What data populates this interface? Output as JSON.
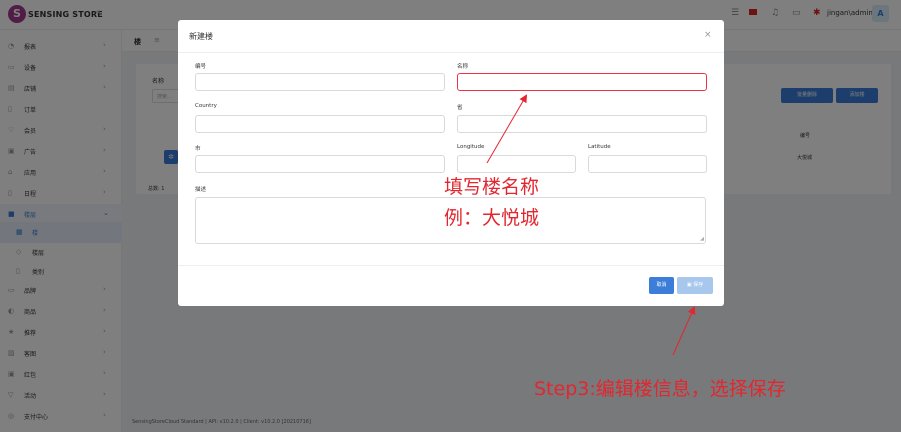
{
  "header": {
    "brand": "SENSING STORE",
    "logo_letter": "S",
    "user": "jingan\\admin",
    "avatar_letter": "A"
  },
  "sidebar": {
    "items": [
      {
        "label": "报表",
        "icon": "chart-icon",
        "has_children": true
      },
      {
        "label": "设备",
        "icon": "device-icon",
        "has_children": true
      },
      {
        "label": "店铺",
        "icon": "store-icon",
        "has_children": true
      },
      {
        "label": "订单",
        "icon": "order-icon",
        "has_children": false
      },
      {
        "label": "会员",
        "icon": "member-icon",
        "has_children": true
      },
      {
        "label": "广告",
        "icon": "ad-icon",
        "has_children": true
      },
      {
        "label": "应用",
        "icon": "app-icon",
        "has_children": true
      },
      {
        "label": "日程",
        "icon": "schedule-icon",
        "has_children": true
      },
      {
        "label": "楼层",
        "icon": "floor-icon",
        "has_children": true,
        "expanded": true
      },
      {
        "label": "楼",
        "icon": "building-icon",
        "sub": true,
        "active": true
      },
      {
        "label": "楼层",
        "icon": "layers-icon",
        "sub": true
      },
      {
        "label": "类别",
        "icon": "category-icon",
        "sub": true
      },
      {
        "label": "品牌",
        "icon": "brand-icon",
        "has_children": true
      },
      {
        "label": "商品",
        "icon": "goods-icon",
        "has_children": true
      },
      {
        "label": "推荐",
        "icon": "star-icon",
        "has_children": true
      },
      {
        "label": "客图",
        "icon": "image-icon",
        "has_children": true
      },
      {
        "label": "红包",
        "icon": "redpacket-icon",
        "has_children": true
      },
      {
        "label": "活动",
        "icon": "activity-icon",
        "has_children": true
      },
      {
        "label": "支付中心",
        "icon": "payment-icon",
        "has_children": true
      }
    ]
  },
  "main": {
    "tab_label": "楼",
    "filter_label": "名称",
    "filter_placeholder": "搜索...",
    "bulk_delete": "批量删除",
    "add_building": "添加楼",
    "column_header": "编号",
    "row_value": "大悦城",
    "total": "总数: 1",
    "footer": "SensingStoreCloud Standard | API: v10.2.0 | Client: v10.2.0 [20210716]"
  },
  "modal": {
    "title": "新建楼",
    "fields": {
      "code_label": "编号",
      "name_label": "名称",
      "country_label": "Country",
      "province_label": "省",
      "city_label": "市",
      "longitude_label": "Longitude",
      "latitude_label": "Latitude",
      "description_label": "描述"
    },
    "cancel": "取消",
    "save": "保存"
  },
  "annotations": {
    "fill_name": "填写楼名称",
    "example": "例：大悦城",
    "step3": "Step3:编辑楼信息，选择保存"
  },
  "colors": {
    "primary": "#3b7dd8",
    "annotation_red": "#e3262f",
    "error_border": "#e34"
  }
}
